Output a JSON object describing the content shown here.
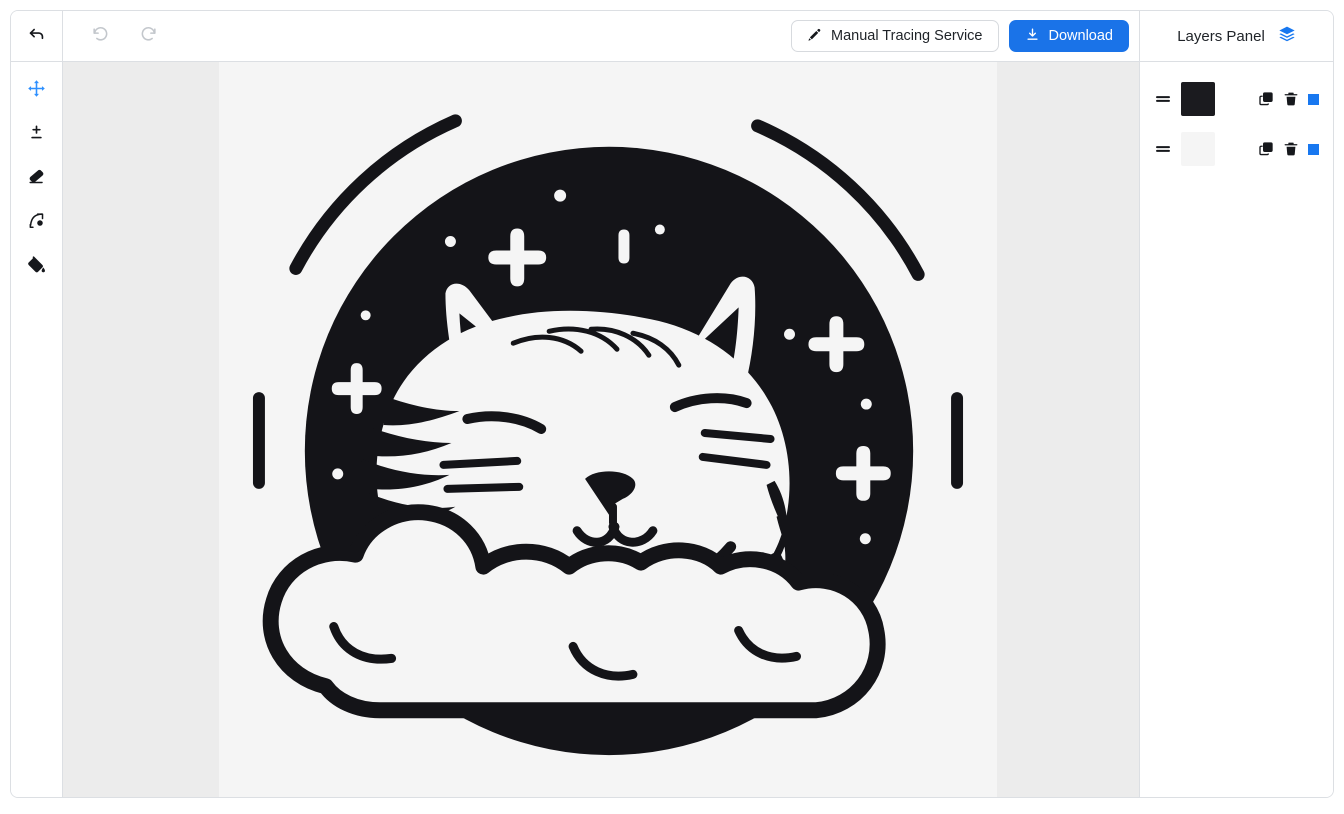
{
  "app": {
    "background": "#ffffff",
    "frame_border": "#dcdfe3"
  },
  "topbar": {
    "back_icon": "back-arrow-icon",
    "undo_icon": "undo-icon",
    "redo_icon": "redo-icon",
    "undo_enabled": false,
    "redo_enabled": false,
    "manual_tracing_label": "Manual Tracing Service",
    "manual_tracing_icon": "brush-icon",
    "download_label": "Download",
    "download_icon": "download-icon",
    "download_color": "#1a73e8"
  },
  "tools": [
    {
      "name": "move-tool",
      "icon": "move-arrows-icon",
      "active": true,
      "color": "#2e90ff"
    },
    {
      "name": "adjust-tool",
      "icon": "plus-minus-icon",
      "active": false,
      "color": "#111418"
    },
    {
      "name": "eraser-tool",
      "icon": "eraser-icon",
      "active": false,
      "color": "#111418"
    },
    {
      "name": "node-edit-tool",
      "icon": "node-edit-icon",
      "active": false,
      "color": "#111418"
    },
    {
      "name": "fill-tool",
      "icon": "paint-bucket-icon",
      "active": false,
      "color": "#111418"
    }
  ],
  "canvas": {
    "background": "#ececec",
    "artboard_background": "#f5f5f5",
    "artwork_dark": "#141418",
    "artwork_light": "#f5f5f5",
    "artwork_description": "sleeping-cat-on-cloud-illustration"
  },
  "layers_panel": {
    "title": "Layers Panel",
    "title_icon": "layers-stack-icon",
    "title_icon_color": "#1878f0",
    "layers": [
      {
        "name": "layer-dark",
        "swatch_color": "#1b1b1f",
        "handle_icon": "drag-handle-icon",
        "duplicate_icon": "duplicate-icon",
        "delete_icon": "trash-icon",
        "visibility_icon": "color-indicator-icon",
        "visibility_color": "#1878f0"
      },
      {
        "name": "layer-light",
        "swatch_color": "#f5f5f5",
        "handle_icon": "drag-handle-icon",
        "duplicate_icon": "duplicate-icon",
        "delete_icon": "trash-icon",
        "visibility_icon": "color-indicator-icon",
        "visibility_color": "#1878f0"
      }
    ]
  }
}
